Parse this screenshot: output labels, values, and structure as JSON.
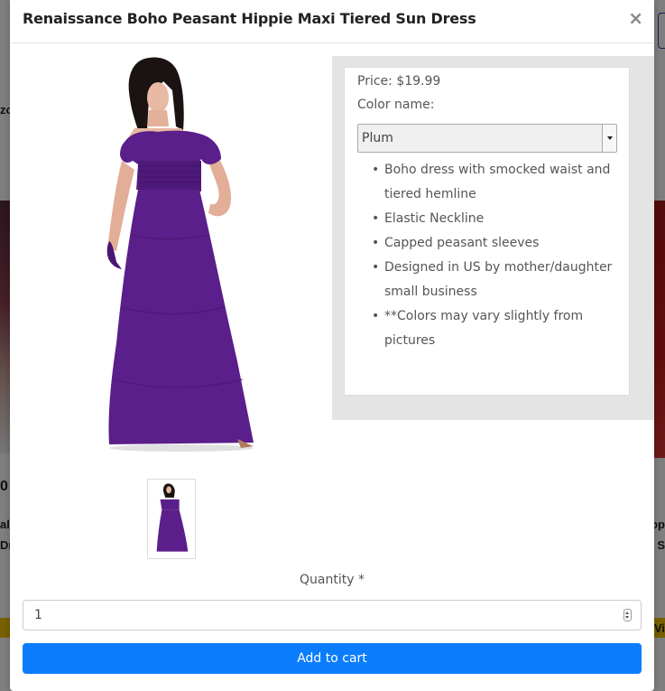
{
  "modal": {
    "title": "Renaissance Boho Peasant Hippie Maxi Tiered Sun Dress",
    "close_label": "×"
  },
  "product": {
    "price": "Price: $19.99",
    "color_label": "Color name:",
    "color_selected": "Plum",
    "features": [
      "Boho dress with smocked waist and tiered hemline",
      "Elastic Neckline",
      "Capped peasant sleeves",
      "Designed in US by mother/daughter small business",
      "**Colors may vary slightly from pictures"
    ],
    "dress_color": "#5a1f8a"
  },
  "quantity": {
    "label": "Quantity *",
    "value": "1"
  },
  "cart": {
    "button_label": "Add to cart",
    "button_color": "#0b7dfc"
  },
  "background": {
    "left_texts": [
      "zo",
      "0",
      "al",
      "Dr"
    ],
    "right_texts": [
      "op",
      "i S",
      "Vi"
    ]
  }
}
